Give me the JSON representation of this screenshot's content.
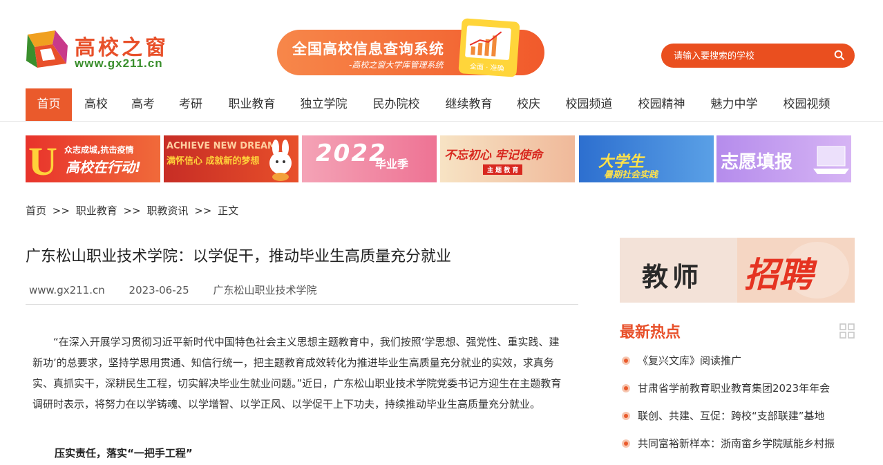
{
  "header": {
    "logo_text": "高校之窗",
    "logo_url": "www.gx211.cn",
    "promo_title": "全国高校信息查询系统",
    "promo_subtitle": "-高校之窗大学库管理系统",
    "promo_badge": "全面 · 准确",
    "search_placeholder": "请输入要搜索的学校"
  },
  "nav": {
    "items": [
      "首页",
      "高校",
      "高考",
      "考研",
      "职业教育",
      "独立学院",
      "民办院校",
      "继续教育",
      "校庆",
      "校园频道",
      "校园精神",
      "魅力中学",
      "校园视频"
    ],
    "active": "首页"
  },
  "banners": [
    {
      "text": "高校在行动!",
      "small": "众志成城,抗击疫情",
      "bg": "#e8332b"
    },
    {
      "text": "满怀信心 成就新的梦想",
      "small": "ACHIEVE NEW DREAM",
      "bg": "#d8382c"
    },
    {
      "text": "2022",
      "small": "毕业季",
      "bg": "#f08aa6"
    },
    {
      "text": "不忘初心 牢记使命",
      "small": "主 题 教 育",
      "bg": "#f2d3a8"
    },
    {
      "text": "大学生",
      "small": "暑期社会实践",
      "bg": "#3b7fd4"
    },
    {
      "text": "志愿填报",
      "small": "",
      "bg": "#c9a3f0"
    }
  ],
  "breadcrumb": [
    "首页",
    ">>",
    "职业教育",
    ">>",
    "职教资讯",
    ">>",
    "正文"
  ],
  "article": {
    "title": "广东松山职业技术学院：以学促干，推动毕业生高质量充分就业",
    "site": "www.gx211.cn",
    "date": "2023-06-25",
    "source": "广东松山职业技术学院",
    "body": "“在深入开展学习贯彻习近平新时代中国特色社会主义思想主题教育中，我们按照‘学思想、强党性、重实践、建新功’的总要求，坚持学思用贯通、知信行统一，把主题教育成效转化为推进毕业生高质量充分就业的实效，求真务实、真抓实干，深耕民生工程，切实解决毕业生就业问题。”近日，广东松山职业技术学院党委书记方迎生在主题教育调研时表示，将努力在以学铸魂、以学增智、以学正风、以学促干上下功夫，持续推动毕业生高质量充分就业。",
    "subheading": "压实责任，落实“一把手工程”"
  },
  "sidebar": {
    "ad_left": "教师",
    "ad_right": "招聘",
    "hot_title": "最新热点",
    "hot_items": [
      "《复兴文库》阅读推广",
      "甘肃省学前教育职业教育集团2023年年会",
      "联创、共建、互促：跨校“支部联建”基地",
      "共同富裕新样本：浙南畲乡学院赋能乡村振"
    ]
  },
  "colors": {
    "accent": "#ea5a2c",
    "logo_green": "#3a8f2d",
    "hot_title": "#e8502a"
  }
}
